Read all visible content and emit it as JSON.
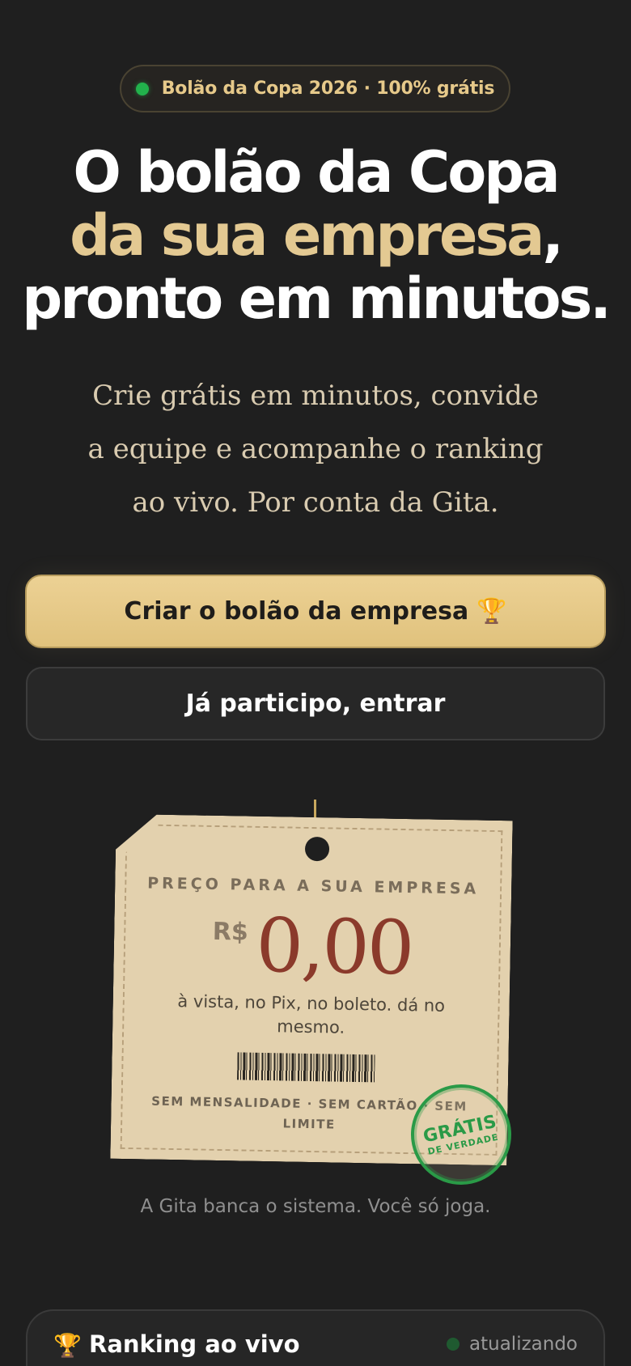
{
  "badge": {
    "text": "Bolão da Copa 2026 · 100% grátis",
    "dot_color": "#22b24c"
  },
  "headline": {
    "line1": "O bolão da Copa",
    "line2_highlight": "da sua empresa",
    "line2_suffix": ",",
    "line3": "pronto em minutos."
  },
  "subtitle": {
    "line1": "Crie grátis em minutos, convide",
    "line2": "a equipe e acompanhe o ranking",
    "line3": "ao vivo. Por conta da Gita."
  },
  "buttons": {
    "primary_label": "Criar o bolão da empresa",
    "primary_icon": "🏆",
    "secondary_label": "Já participo, entrar"
  },
  "price_tag": {
    "heading": "PREÇO PARA A SUA EMPRESA",
    "currency": "R$",
    "amount": "0,00",
    "description": "à vista, no Pix, no boleto. dá no mesmo.",
    "footer": "SEM MENSALIDADE · SEM CARTÃO · SEM LIMITE",
    "stamp_main": "GRÁTIS",
    "stamp_sub": "DE VERDADE"
  },
  "caption": "A Gita banca o sistema. Você só joga.",
  "ranking": {
    "icon": "🏆",
    "title": "Ranking ao vivo",
    "status": "atualizando"
  },
  "colors": {
    "background": "#1f1f1f",
    "gold": "#e3c992",
    "primary_button": "#e6c98a",
    "price": "#8b3a2b",
    "stamp": "#2a9a47"
  }
}
